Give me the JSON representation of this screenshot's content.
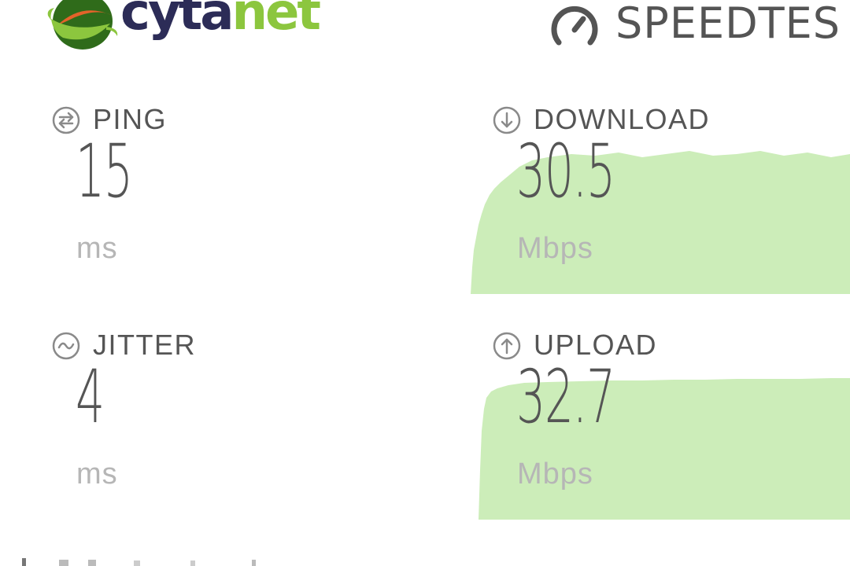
{
  "header": {
    "isp_logo": {
      "text_dark": "cyta",
      "text_green": "net",
      "icon": "globe-swirl-logo-icon",
      "colors": {
        "dark": "#2c2c57",
        "green": "#8cc63e"
      }
    },
    "brand": {
      "icon": "speedometer-icon",
      "text": "SPEEDTES"
    }
  },
  "metrics": {
    "ping": {
      "label": "PING",
      "value": "15",
      "unit": "ms",
      "icon": "ping-icon"
    },
    "jitter": {
      "label": "JITTER",
      "value": "4",
      "unit": "ms",
      "icon": "jitter-wave-icon"
    },
    "download": {
      "label": "DOWNLOAD",
      "value": "30.5",
      "unit": "Mbps",
      "icon": "download-arrow-icon"
    },
    "upload": {
      "label": "UPLOAD",
      "value": "32.7",
      "unit": "Mbps",
      "icon": "upload-arrow-icon"
    }
  },
  "colors": {
    "graph_fill": "#ccedb9",
    "text": "#555555",
    "unit_text": "#b6b6b6",
    "icon_stroke": "#8a8a8a"
  }
}
